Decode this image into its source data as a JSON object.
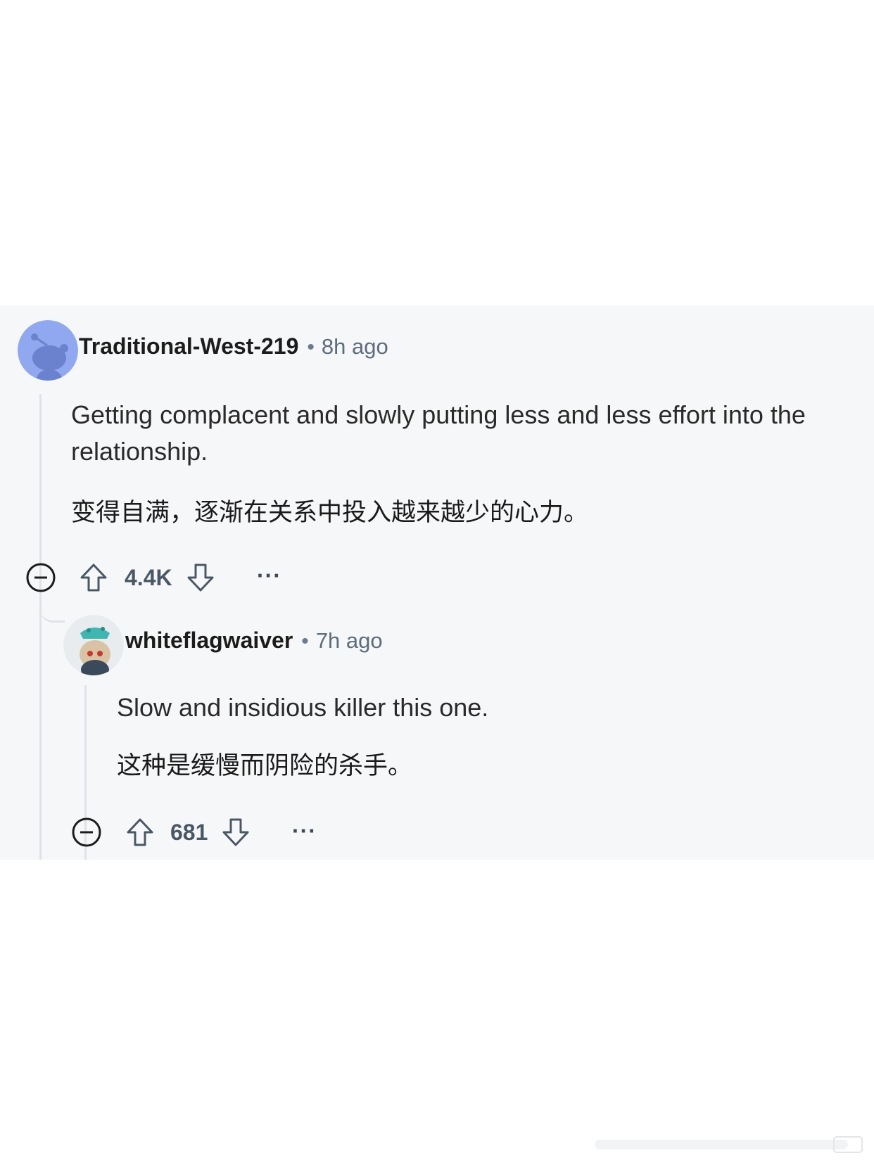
{
  "comments": [
    {
      "username": "Traditional-West-219",
      "separator": "•",
      "time": "8h ago",
      "body": "Getting complacent and slowly putting less and less effort into the relationship.",
      "translation": "变得自满，逐渐在关系中投入越来越少的心力。",
      "score": "4.4K",
      "more": "···",
      "avatar_color": "#8fa8f0"
    },
    {
      "username": "whiteflagwaiver",
      "separator": "•",
      "time": "7h ago",
      "body": "Slow and insidious killer this one.",
      "translation": "这种是缓慢而阴险的杀手。",
      "score": "681",
      "more": "···"
    }
  ],
  "icons": {
    "collapse": "collapse-minus-icon",
    "upvote": "upvote-arrow-icon",
    "downvote": "downvote-arrow-icon",
    "more": "more-dots-icon"
  },
  "colors": {
    "panel_bg": "#f6f7f9",
    "thread_line": "#dfe3e8",
    "text": "#1c1c1c",
    "muted": "#5c6c7c"
  }
}
